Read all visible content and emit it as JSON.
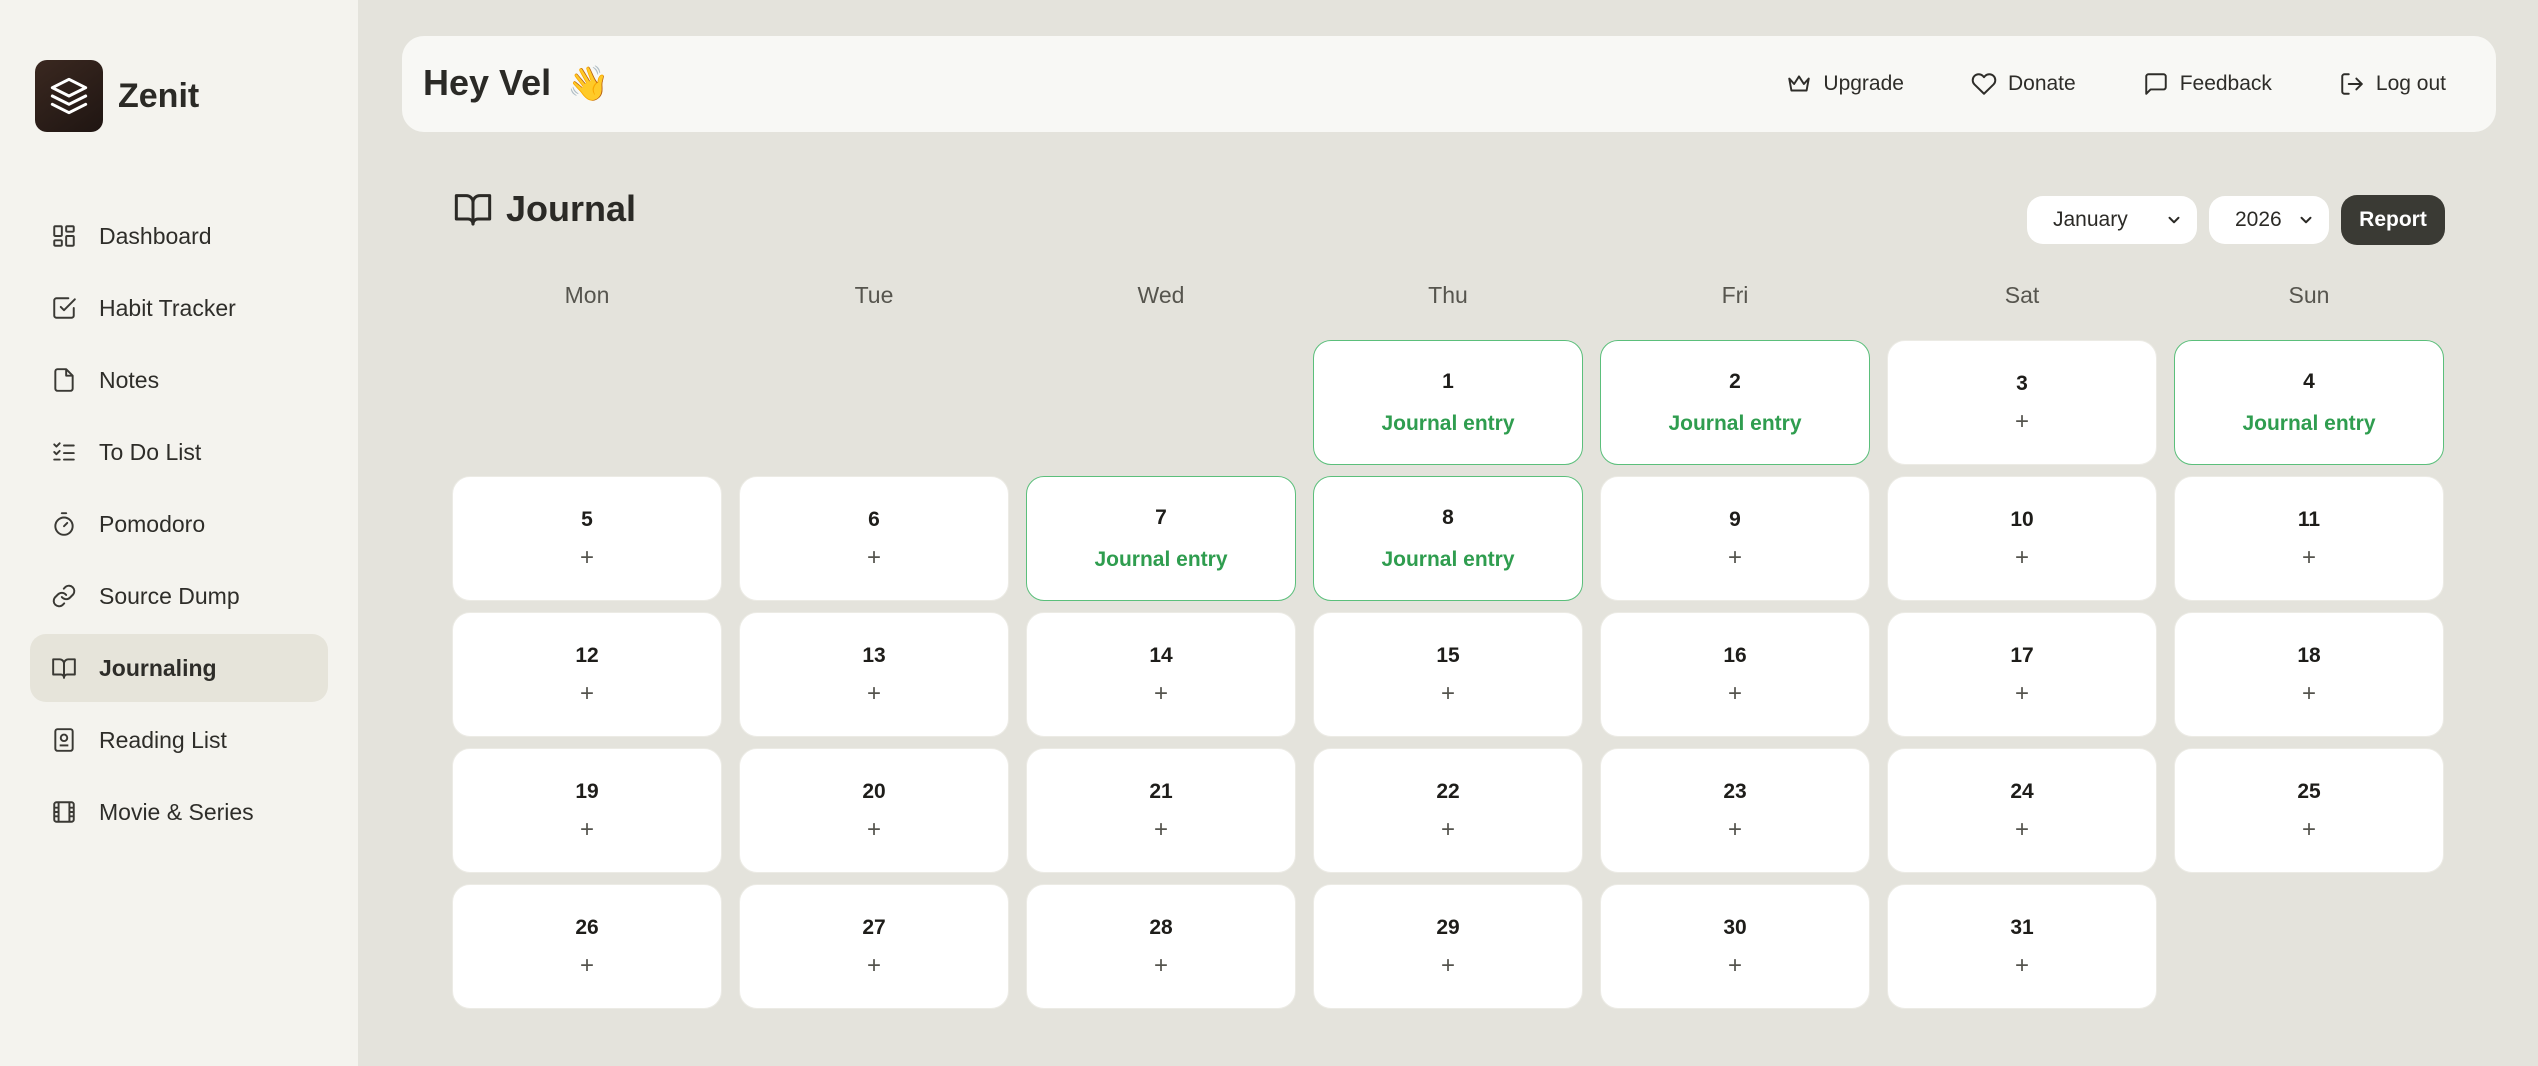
{
  "app": {
    "name": "Zenit"
  },
  "sidebar": {
    "items": [
      {
        "label": "Dashboard",
        "icon": "dashboard-icon",
        "active": false
      },
      {
        "label": "Habit Tracker",
        "icon": "check-square-icon",
        "active": false
      },
      {
        "label": "Notes",
        "icon": "file-icon",
        "active": false
      },
      {
        "label": "To Do List",
        "icon": "list-checks-icon",
        "active": false
      },
      {
        "label": "Pomodoro",
        "icon": "timer-icon",
        "active": false
      },
      {
        "label": "Source Dump",
        "icon": "link-icon",
        "active": false
      },
      {
        "label": "Journaling",
        "icon": "book-open-icon",
        "active": true
      },
      {
        "label": "Reading List",
        "icon": "book-contact-icon",
        "active": false
      },
      {
        "label": "Movie & Series",
        "icon": "film-icon",
        "active": false
      }
    ]
  },
  "header": {
    "greeting": "Hey Vel",
    "wave": "👋",
    "actions": [
      {
        "label": "Upgrade",
        "icon": "crown-icon"
      },
      {
        "label": "Donate",
        "icon": "heart-icon"
      },
      {
        "label": "Feedback",
        "icon": "message-icon"
      },
      {
        "label": "Log out",
        "icon": "logout-icon"
      }
    ]
  },
  "journal": {
    "title": "Journal",
    "month": "January",
    "year": "2026",
    "report_label": "Report",
    "weekdays": [
      "Mon",
      "Tue",
      "Wed",
      "Thu",
      "Fri",
      "Sat",
      "Sun"
    ],
    "leading_empty": 3,
    "entry_label": "Journal entry",
    "add_symbol": "+",
    "days": [
      {
        "day": 1,
        "has_entry": true
      },
      {
        "day": 2,
        "has_entry": true
      },
      {
        "day": 3,
        "has_entry": false
      },
      {
        "day": 4,
        "has_entry": true
      },
      {
        "day": 5,
        "has_entry": false
      },
      {
        "day": 6,
        "has_entry": false
      },
      {
        "day": 7,
        "has_entry": true
      },
      {
        "day": 8,
        "has_entry": true
      },
      {
        "day": 9,
        "has_entry": false
      },
      {
        "day": 10,
        "has_entry": false
      },
      {
        "day": 11,
        "has_entry": false
      },
      {
        "day": 12,
        "has_entry": false
      },
      {
        "day": 13,
        "has_entry": false
      },
      {
        "day": 14,
        "has_entry": false
      },
      {
        "day": 15,
        "has_entry": false
      },
      {
        "day": 16,
        "has_entry": false
      },
      {
        "day": 17,
        "has_entry": false
      },
      {
        "day": 18,
        "has_entry": false
      },
      {
        "day": 19,
        "has_entry": false
      },
      {
        "day": 20,
        "has_entry": false
      },
      {
        "day": 21,
        "has_entry": false
      },
      {
        "day": 22,
        "has_entry": false
      },
      {
        "day": 23,
        "has_entry": false
      },
      {
        "day": 24,
        "has_entry": false
      },
      {
        "day": 25,
        "has_entry": false
      },
      {
        "day": 26,
        "has_entry": false
      },
      {
        "day": 27,
        "has_entry": false
      },
      {
        "day": 28,
        "has_entry": false
      },
      {
        "day": 29,
        "has_entry": false
      },
      {
        "day": 30,
        "has_entry": false
      },
      {
        "day": 31,
        "has_entry": false
      }
    ]
  },
  "colors": {
    "entry_green": "#2f9d4f",
    "entry_border": "#5bbf7b",
    "active_nav": "#e6e4da",
    "report_button": "#3a3a34"
  }
}
